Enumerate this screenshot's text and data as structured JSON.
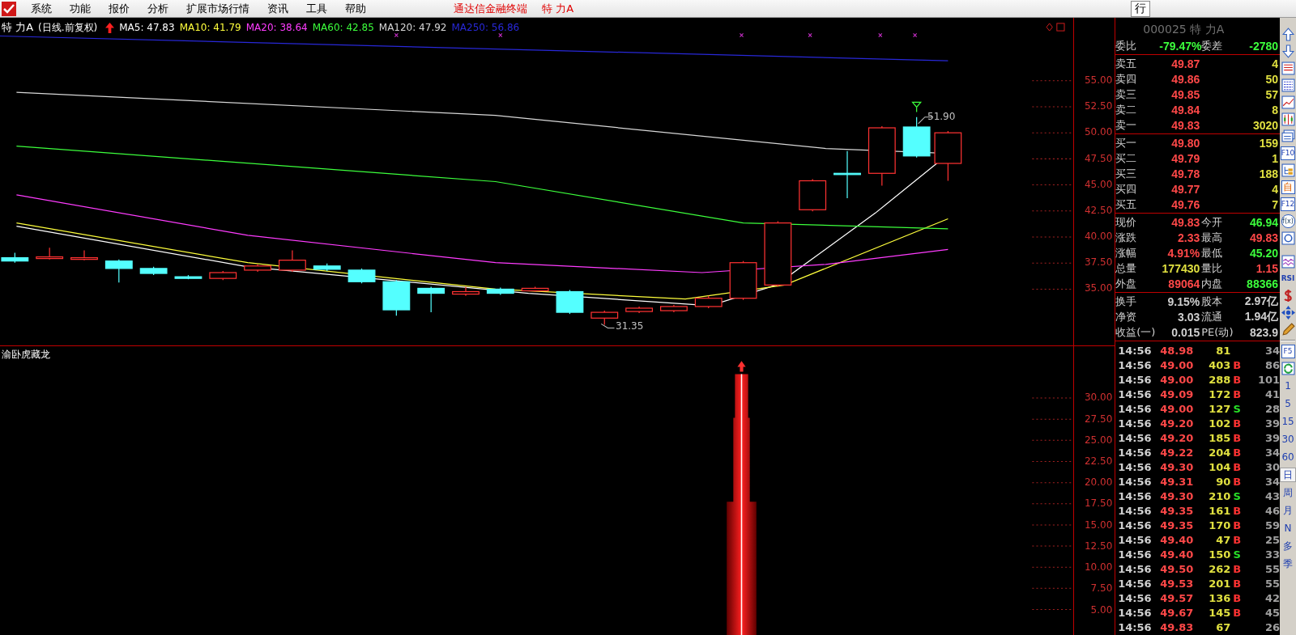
{
  "menu": {
    "items": [
      "系统",
      "功能",
      "报价",
      "分析",
      "扩展市场行情",
      "资讯",
      "工具",
      "帮助"
    ],
    "app_title": "通达信金融终端",
    "stock_title": "特 力A",
    "right_button": "行"
  },
  "chart": {
    "stock_name": "特 力A",
    "mode": "(日线.前复权)",
    "ma": [
      {
        "label": "MA5: 47.83",
        "color": "#ffffff"
      },
      {
        "label": "MA10: 41.79",
        "color": "#ffff3c"
      },
      {
        "label": "MA20: 38.64",
        "color": "#ff3cff"
      },
      {
        "label": "MA60: 42.85",
        "color": "#3cff3c"
      },
      {
        "label": "MA120: 47.92",
        "color": "#d8d8d8"
      },
      {
        "label": "MA250: 56.86",
        "color": "#2828d8"
      }
    ],
    "price_axis": [
      "55.00",
      "52.50",
      "50.00",
      "47.50",
      "45.00",
      "42.50",
      "40.00",
      "37.50",
      "35.00"
    ],
    "high_label": "51.90",
    "low_label": "31.35"
  },
  "indicator": {
    "title": "渝卧虎藏龙",
    "axis": [
      "30.00",
      "27.50",
      "25.00",
      "22.50",
      "20.00",
      "17.50",
      "15.00",
      "12.50",
      "10.00",
      "7.50",
      "5.00"
    ]
  },
  "quote": {
    "header": "000025 特 力A",
    "ratio": [
      {
        "label": "委比",
        "value": "-79.47%",
        "color": "#3cff3c"
      },
      {
        "label": "委差",
        "value": "-2780",
        "color": "#3cff3c"
      }
    ],
    "sell": [
      {
        "label": "卖五",
        "price": "49.87",
        "volume": "4"
      },
      {
        "label": "卖四",
        "price": "49.86",
        "volume": "50"
      },
      {
        "label": "卖三",
        "price": "49.85",
        "volume": "57"
      },
      {
        "label": "卖二",
        "price": "49.84",
        "volume": "8"
      },
      {
        "label": "卖一",
        "price": "49.83",
        "volume": "3020"
      }
    ],
    "buy": [
      {
        "label": "买一",
        "price": "49.80",
        "volume": "159"
      },
      {
        "label": "买二",
        "price": "49.79",
        "volume": "1"
      },
      {
        "label": "买三",
        "price": "49.78",
        "volume": "188"
      },
      {
        "label": "买四",
        "price": "49.77",
        "volume": "4"
      },
      {
        "label": "买五",
        "price": "49.76",
        "volume": "7"
      }
    ],
    "stats": [
      [
        {
          "label": "现价",
          "value": "49.83",
          "color": "#ff4848"
        },
        {
          "label": "今开",
          "value": "46.94",
          "color": "#3cff3c"
        }
      ],
      [
        {
          "label": "涨跌",
          "value": "2.33",
          "color": "#ff4848"
        },
        {
          "label": "最高",
          "value": "49.83",
          "color": "#ff4848"
        }
      ],
      [
        {
          "label": "涨幅",
          "value": "4.91%",
          "color": "#ff4848"
        },
        {
          "label": "最低",
          "value": "45.20",
          "color": "#3cff3c"
        }
      ],
      [
        {
          "label": "总量",
          "value": "177430",
          "color": "#e0e040"
        },
        {
          "label": "量比",
          "value": "1.15",
          "color": "#ff4848"
        }
      ],
      [
        {
          "label": "外盘",
          "value": "89064",
          "color": "#ff4848"
        },
        {
          "label": "内盘",
          "value": "88366",
          "color": "#3cff3c"
        }
      ]
    ],
    "finance": [
      [
        {
          "label": "换手",
          "value": "9.15%"
        },
        {
          "label": "股本",
          "value": "2.97亿"
        }
      ],
      [
        {
          "label": "净资",
          "value": "3.03"
        },
        {
          "label": "流通",
          "value": "1.94亿"
        }
      ],
      [
        {
          "label": "收益(一)",
          "value": "0.015"
        },
        {
          "label": "PE(动)",
          "value": "823.9"
        }
      ]
    ]
  },
  "trades": [
    {
      "time": "14:56",
      "price": "48.98",
      "volume": "81",
      "count": "34"
    },
    {
      "time": "14:56",
      "price": "49.00",
      "volume": "403",
      "side": "B",
      "color": "#ff3232",
      "count": "86"
    },
    {
      "time": "14:56",
      "price": "49.00",
      "volume": "288",
      "side": "B",
      "color": "#ff3232",
      "count": "101"
    },
    {
      "time": "14:56",
      "price": "49.09",
      "volume": "172",
      "side": "B",
      "color": "#ff3232",
      "count": "41"
    },
    {
      "time": "14:56",
      "price": "49.00",
      "volume": "127",
      "side": "S",
      "color": "#28e028",
      "count": "28"
    },
    {
      "time": "14:56",
      "price": "49.20",
      "volume": "102",
      "side": "B",
      "color": "#ff3232",
      "count": "39"
    },
    {
      "time": "14:56",
      "price": "49.20",
      "volume": "185",
      "side": "B",
      "color": "#ff3232",
      "count": "39"
    },
    {
      "time": "14:56",
      "price": "49.22",
      "volume": "204",
      "side": "B",
      "color": "#ff3232",
      "count": "34"
    },
    {
      "time": "14:56",
      "price": "49.30",
      "volume": "104",
      "side": "B",
      "color": "#ff3232",
      "count": "30"
    },
    {
      "time": "14:56",
      "price": "49.31",
      "volume": "90",
      "side": "B",
      "color": "#ff3232",
      "count": "34"
    },
    {
      "time": "14:56",
      "price": "49.30",
      "volume": "210",
      "side": "S",
      "color": "#28e028",
      "count": "43"
    },
    {
      "time": "14:56",
      "price": "49.35",
      "volume": "161",
      "side": "B",
      "color": "#ff3232",
      "count": "46"
    },
    {
      "time": "14:56",
      "price": "49.35",
      "volume": "170",
      "side": "B",
      "color": "#ff3232",
      "count": "59"
    },
    {
      "time": "14:56",
      "price": "49.40",
      "volume": "47",
      "side": "B",
      "color": "#ff3232",
      "count": "25"
    },
    {
      "time": "14:56",
      "price": "49.40",
      "volume": "150",
      "side": "S",
      "color": "#28e028",
      "count": "33"
    },
    {
      "time": "14:56",
      "price": "49.50",
      "volume": "262",
      "side": "B",
      "color": "#ff3232",
      "count": "55"
    },
    {
      "time": "14:56",
      "price": "49.53",
      "volume": "201",
      "side": "B",
      "color": "#ff3232",
      "count": "55"
    },
    {
      "time": "14:56",
      "price": "49.57",
      "volume": "136",
      "side": "B",
      "color": "#ff3232",
      "count": "42"
    },
    {
      "time": "14:56",
      "price": "49.67",
      "volume": "145",
      "side": "B",
      "color": "#ff3232",
      "count": "45"
    },
    {
      "time": "14:56",
      "price": "49.83",
      "volume": "67",
      "count": "26"
    }
  ],
  "toolbar_labels": [
    "F10",
    "自",
    "F12",
    "f(x)",
    "RSI",
    "F5"
  ],
  "periods": [
    {
      "label": "1",
      "selected": false
    },
    {
      "label": "5",
      "selected": false
    },
    {
      "label": "15",
      "selected": false
    },
    {
      "label": "30",
      "selected": false
    },
    {
      "label": "60",
      "selected": false
    },
    {
      "label": "日",
      "selected": true
    },
    {
      "label": "周",
      "selected": false
    },
    {
      "label": "月",
      "selected": false
    },
    {
      "label": "N",
      "selected": false
    },
    {
      "label": "多",
      "selected": false
    },
    {
      "label": "季",
      "selected": false
    }
  ]
}
